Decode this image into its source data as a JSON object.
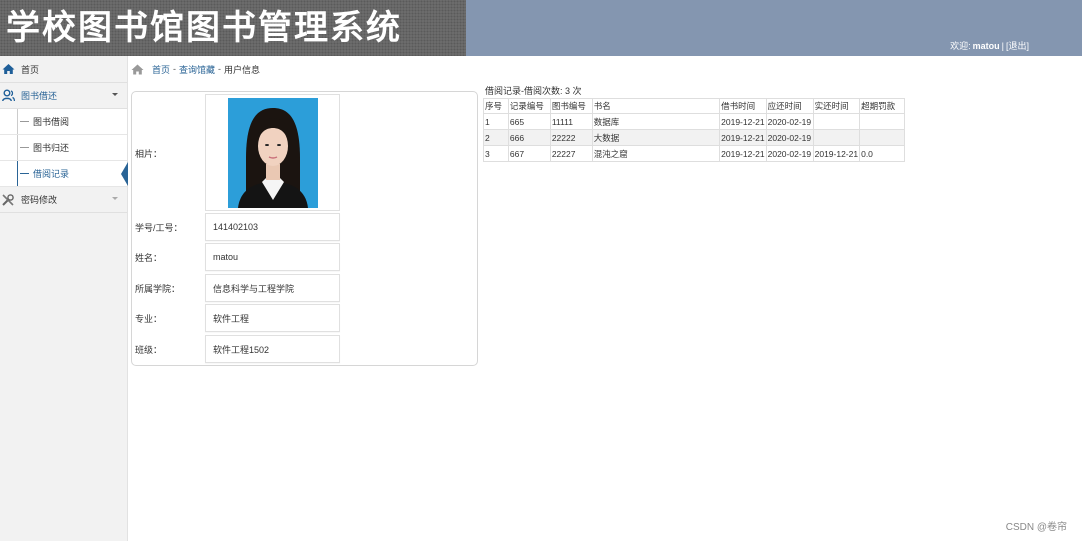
{
  "header": {
    "title": "学校图书馆图书管理系统",
    "welcome_prefix": "欢迎:",
    "user": "matou",
    "separator": "|",
    "logout": "[退出]"
  },
  "sidebar": {
    "home": "首页",
    "group_borrow": "图书借还",
    "sub_items": [
      "图书借阅",
      "图书归还",
      "借阅记录"
    ],
    "group_password": "密码修改"
  },
  "breadcrumb": {
    "home": "首页",
    "sep": "-",
    "query": "查询馆藏",
    "current": "用户信息"
  },
  "profile": {
    "photo_label": "相片：",
    "fields": [
      {
        "label": "学号/工号：",
        "value": "141402103"
      },
      {
        "label": "姓名：",
        "value": "matou"
      },
      {
        "label": "所属学院：",
        "value": "信息科学与工程学院"
      },
      {
        "label": "专业：",
        "value": "软件工程"
      },
      {
        "label": "班级：",
        "value": "软件工程1502"
      }
    ]
  },
  "records": {
    "title": "借阅记录-借阅次数: 3 次",
    "headers": [
      "序号",
      "记录编号",
      "图书编号",
      "书名",
      "借书时间",
      "应还时间",
      "实还时间",
      "超期罚款"
    ],
    "rows": [
      [
        "1",
        "665",
        "11111",
        "数据库",
        "2019-12-21",
        "2020-02-19",
        "",
        ""
      ],
      [
        "2",
        "666",
        "22222",
        "大数据",
        "2019-12-21",
        "2020-02-19",
        "",
        ""
      ],
      [
        "3",
        "667",
        "22227",
        "混沌之窟",
        "2019-12-21",
        "2020-02-19",
        "2019-12-21",
        "0.0"
      ]
    ]
  },
  "watermark": "CSDN @卷帘",
  "colors": {
    "header_bg": "#8496b0",
    "link": "#2a6496",
    "sidebar_bg": "#f2f2f2"
  }
}
